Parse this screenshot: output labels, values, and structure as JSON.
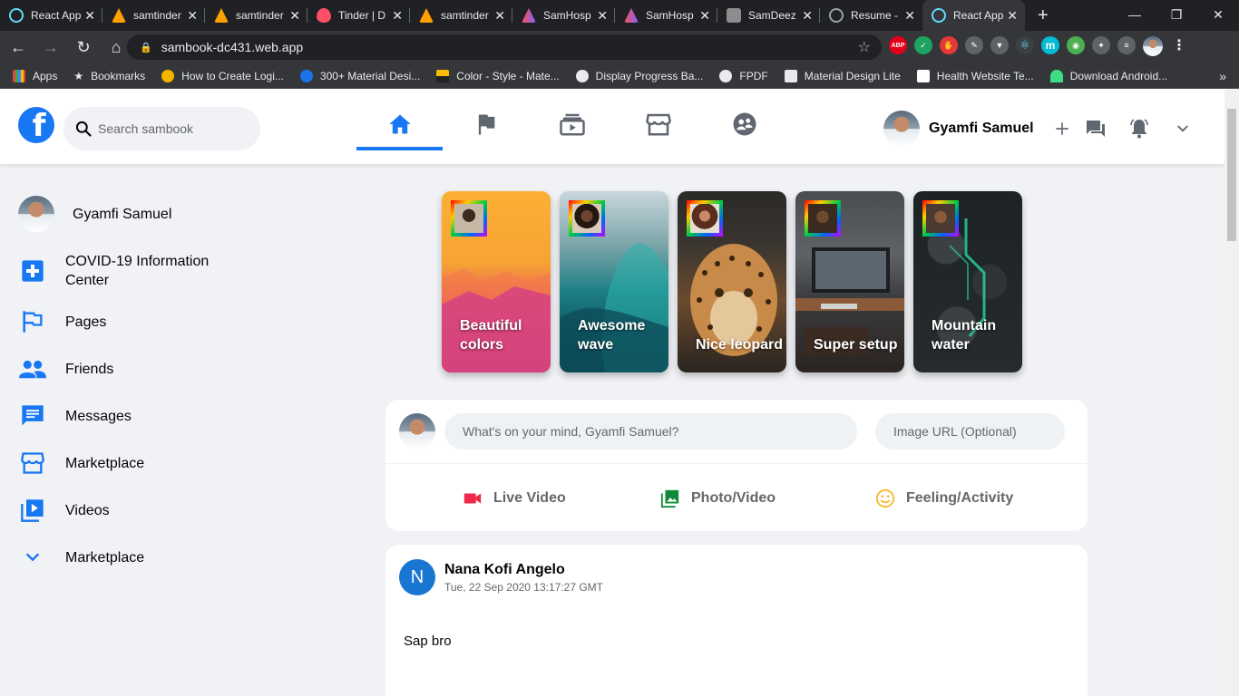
{
  "browser": {
    "tabs": [
      {
        "title": "React App",
        "favicon_color": "#61dafb"
      },
      {
        "title": "samtinder",
        "favicon_color": "#ffa000"
      },
      {
        "title": "samtinder",
        "favicon_color": "#ffa000"
      },
      {
        "title": "Tinder | D",
        "favicon_color": "#fd5068"
      },
      {
        "title": "samtinder",
        "favicon_color": "#ffa000"
      },
      {
        "title": "SamHosp",
        "favicon_color": "#7b61ff"
      },
      {
        "title": "SamHosp",
        "favicon_color": "#7b61ff"
      },
      {
        "title": "SamDeez",
        "favicon_color": "#8d8d8d"
      },
      {
        "title": "Resume -",
        "favicon_color": "#9aa0a6"
      },
      {
        "title": "React App",
        "favicon_color": "#61dafb",
        "active": true
      }
    ],
    "url": "sambook-dc431.web.app",
    "bookmarks": [
      {
        "label": "Apps",
        "icon_color": "#ea4335"
      },
      {
        "label": "Bookmarks",
        "icon_color": "#e8eaed"
      },
      {
        "label": "How to Create Logi...",
        "icon_color": "#f4b400"
      },
      {
        "label": "300+ Material Desi...",
        "icon_color": "#1a73e8"
      },
      {
        "label": "Color - Style - Mate...",
        "icon_color": "#fbbc04"
      },
      {
        "label": "Display Progress Ba...",
        "icon_color": "#e8eaed"
      },
      {
        "label": "FPDF",
        "icon_color": "#e8eaed"
      },
      {
        "label": "Material Design Lite",
        "icon_color": "#e8eaed"
      },
      {
        "label": "Health Website Te...",
        "icon_color": "#ffffff"
      },
      {
        "label": "Download Android...",
        "icon_color": "#3ddc84"
      }
    ],
    "extensions": [
      {
        "label": "ABP",
        "color": "#e4001b"
      },
      {
        "label": "✓",
        "color": "#1ea362"
      },
      {
        "label": "✋",
        "color": "#e53935"
      },
      {
        "label": "✎",
        "color": "#5f6368"
      },
      {
        "label": "▼",
        "color": "#5f6368"
      },
      {
        "label": "⚛",
        "color": "#3c4043"
      },
      {
        "label": "m",
        "color": "#00bcd4"
      },
      {
        "label": "◉",
        "color": "#4caf50"
      },
      {
        "label": "✦",
        "color": "#5f6368"
      },
      {
        "label": "≡",
        "color": "#5f6368"
      }
    ]
  },
  "header": {
    "logo": "f",
    "search_placeholder": "Search sambook",
    "user_name": "Gyamfi Samuel",
    "accent": "#1877f2"
  },
  "sidebar": {
    "user_name": "Gyamfi Samuel",
    "items": [
      {
        "label": "COVID-19 Information Center",
        "icon": "medical-cross-icon"
      },
      {
        "label": "Pages",
        "icon": "flag-icon"
      },
      {
        "label": "Friends",
        "icon": "people-icon"
      },
      {
        "label": "Messages",
        "icon": "chat-icon"
      },
      {
        "label": "Marketplace",
        "icon": "storefront-icon"
      },
      {
        "label": "Videos",
        "icon": "video-library-icon"
      },
      {
        "label": "Marketplace",
        "icon": "chevron-down-icon"
      }
    ]
  },
  "stories": [
    {
      "caption": "Beautiful colors"
    },
    {
      "caption": "Awesome wave"
    },
    {
      "caption": "Nice leopard"
    },
    {
      "caption": "Super setup"
    },
    {
      "caption": "Mountain water"
    }
  ],
  "composer": {
    "placeholder": "What's on your mind, Gyamfi Samuel?",
    "image_placeholder": "Image URL (Optional)",
    "options": [
      {
        "label": "Live Video",
        "color": "#f02849"
      },
      {
        "label": "Photo/Video",
        "color": "#45bd62"
      },
      {
        "label": "Feeling/Activity",
        "color": "#f7b928"
      }
    ]
  },
  "post": {
    "avatar_letter": "N",
    "author": "Nana Kofi Angelo",
    "timestamp": "Tue, 22 Sep 2020 13:17:27 GMT",
    "message": "Sap bro"
  }
}
